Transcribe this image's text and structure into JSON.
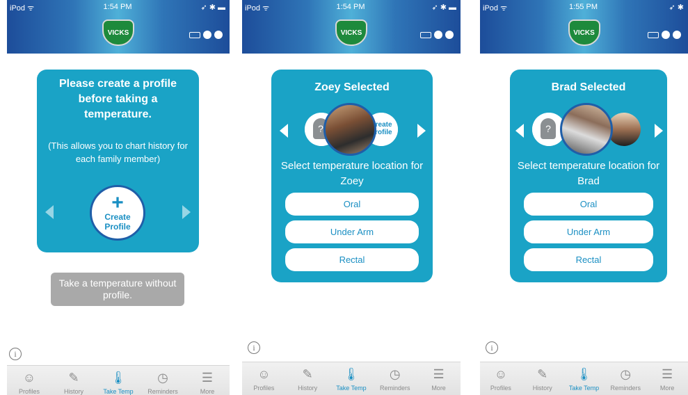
{
  "colors": {
    "accent": "#1aa3c6",
    "brand": "#1e8a3c",
    "header": "#2f75b7",
    "button_gray": "#a9a9a9"
  },
  "screens": [
    {
      "status": {
        "carrier": "iPod ᯤ",
        "time": "1:54 PM",
        "right": "➶ ✱ ▬"
      },
      "logo": "VICKS",
      "card": {
        "title": "Please create a profile before taking a temperature.",
        "note": "(This allows you to chart history for each family member)",
        "create_label_1": "Create",
        "create_label_2": "Profile",
        "plus": "+"
      },
      "no_profile_button": "Take a temperature without profile.",
      "info": "i",
      "tabs": [
        {
          "label": "Profiles",
          "icon": "person-icon"
        },
        {
          "label": "History",
          "icon": "notepad-icon"
        },
        {
          "label": "Take Temp",
          "icon": "thermometer-icon"
        },
        {
          "label": "Reminders",
          "icon": "clock-icon"
        },
        {
          "label": "More",
          "icon": "menu-icon"
        }
      ]
    },
    {
      "status": {
        "carrier": "iPod ᯤ",
        "time": "1:54 PM",
        "right": "➶ ✱ ▬"
      },
      "logo": "VICKS",
      "card": {
        "title": "Zoey Selected",
        "select_label": "Select temperature location for Zoey",
        "options": [
          "Oral",
          "Under Arm",
          "Rectal"
        ],
        "mini_create": "Create Profile"
      },
      "info": "i",
      "tabs": [
        {
          "label": "Profiles",
          "icon": "person-icon"
        },
        {
          "label": "History",
          "icon": "notepad-icon"
        },
        {
          "label": "Take Temp",
          "icon": "thermometer-icon"
        },
        {
          "label": "Reminders",
          "icon": "clock-icon"
        },
        {
          "label": "More",
          "icon": "menu-icon"
        }
      ]
    },
    {
      "status": {
        "carrier": "iPod ᯤ",
        "time": "1:55 PM",
        "right": "➶ ✱"
      },
      "logo": "VICKS",
      "card": {
        "title": "Brad Selected",
        "select_label": "Select temperature location for Brad",
        "options": [
          "Oral",
          "Under Arm",
          "Rectal"
        ]
      },
      "info": "i",
      "tabs": [
        {
          "label": "Profiles",
          "icon": "person-icon"
        },
        {
          "label": "History",
          "icon": "notepad-icon"
        },
        {
          "label": "Take Temp",
          "icon": "thermometer-icon"
        },
        {
          "label": "Reminders",
          "icon": "clock-icon"
        },
        {
          "label": "More",
          "icon": "menu-icon"
        }
      ]
    }
  ]
}
